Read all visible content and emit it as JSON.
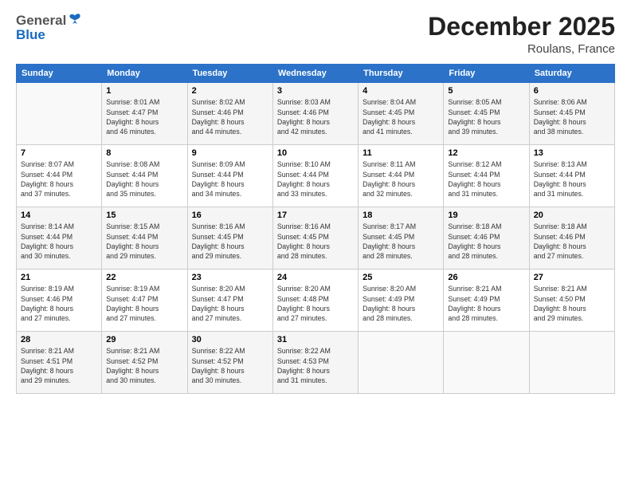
{
  "header": {
    "logo_general": "General",
    "logo_blue": "Blue",
    "month_title": "December 2025",
    "location": "Roulans, France"
  },
  "days_of_week": [
    "Sunday",
    "Monday",
    "Tuesday",
    "Wednesday",
    "Thursday",
    "Friday",
    "Saturday"
  ],
  "weeks": [
    [
      {
        "day": "",
        "info": ""
      },
      {
        "day": "1",
        "info": "Sunrise: 8:01 AM\nSunset: 4:47 PM\nDaylight: 8 hours\nand 46 minutes."
      },
      {
        "day": "2",
        "info": "Sunrise: 8:02 AM\nSunset: 4:46 PM\nDaylight: 8 hours\nand 44 minutes."
      },
      {
        "day": "3",
        "info": "Sunrise: 8:03 AM\nSunset: 4:46 PM\nDaylight: 8 hours\nand 42 minutes."
      },
      {
        "day": "4",
        "info": "Sunrise: 8:04 AM\nSunset: 4:45 PM\nDaylight: 8 hours\nand 41 minutes."
      },
      {
        "day": "5",
        "info": "Sunrise: 8:05 AM\nSunset: 4:45 PM\nDaylight: 8 hours\nand 39 minutes."
      },
      {
        "day": "6",
        "info": "Sunrise: 8:06 AM\nSunset: 4:45 PM\nDaylight: 8 hours\nand 38 minutes."
      }
    ],
    [
      {
        "day": "7",
        "info": "Sunrise: 8:07 AM\nSunset: 4:44 PM\nDaylight: 8 hours\nand 37 minutes."
      },
      {
        "day": "8",
        "info": "Sunrise: 8:08 AM\nSunset: 4:44 PM\nDaylight: 8 hours\nand 35 minutes."
      },
      {
        "day": "9",
        "info": "Sunrise: 8:09 AM\nSunset: 4:44 PM\nDaylight: 8 hours\nand 34 minutes."
      },
      {
        "day": "10",
        "info": "Sunrise: 8:10 AM\nSunset: 4:44 PM\nDaylight: 8 hours\nand 33 minutes."
      },
      {
        "day": "11",
        "info": "Sunrise: 8:11 AM\nSunset: 4:44 PM\nDaylight: 8 hours\nand 32 minutes."
      },
      {
        "day": "12",
        "info": "Sunrise: 8:12 AM\nSunset: 4:44 PM\nDaylight: 8 hours\nand 31 minutes."
      },
      {
        "day": "13",
        "info": "Sunrise: 8:13 AM\nSunset: 4:44 PM\nDaylight: 8 hours\nand 31 minutes."
      }
    ],
    [
      {
        "day": "14",
        "info": "Sunrise: 8:14 AM\nSunset: 4:44 PM\nDaylight: 8 hours\nand 30 minutes."
      },
      {
        "day": "15",
        "info": "Sunrise: 8:15 AM\nSunset: 4:44 PM\nDaylight: 8 hours\nand 29 minutes."
      },
      {
        "day": "16",
        "info": "Sunrise: 8:16 AM\nSunset: 4:45 PM\nDaylight: 8 hours\nand 29 minutes."
      },
      {
        "day": "17",
        "info": "Sunrise: 8:16 AM\nSunset: 4:45 PM\nDaylight: 8 hours\nand 28 minutes."
      },
      {
        "day": "18",
        "info": "Sunrise: 8:17 AM\nSunset: 4:45 PM\nDaylight: 8 hours\nand 28 minutes."
      },
      {
        "day": "19",
        "info": "Sunrise: 8:18 AM\nSunset: 4:46 PM\nDaylight: 8 hours\nand 28 minutes."
      },
      {
        "day": "20",
        "info": "Sunrise: 8:18 AM\nSunset: 4:46 PM\nDaylight: 8 hours\nand 27 minutes."
      }
    ],
    [
      {
        "day": "21",
        "info": "Sunrise: 8:19 AM\nSunset: 4:46 PM\nDaylight: 8 hours\nand 27 minutes."
      },
      {
        "day": "22",
        "info": "Sunrise: 8:19 AM\nSunset: 4:47 PM\nDaylight: 8 hours\nand 27 minutes."
      },
      {
        "day": "23",
        "info": "Sunrise: 8:20 AM\nSunset: 4:47 PM\nDaylight: 8 hours\nand 27 minutes."
      },
      {
        "day": "24",
        "info": "Sunrise: 8:20 AM\nSunset: 4:48 PM\nDaylight: 8 hours\nand 27 minutes."
      },
      {
        "day": "25",
        "info": "Sunrise: 8:20 AM\nSunset: 4:49 PM\nDaylight: 8 hours\nand 28 minutes."
      },
      {
        "day": "26",
        "info": "Sunrise: 8:21 AM\nSunset: 4:49 PM\nDaylight: 8 hours\nand 28 minutes."
      },
      {
        "day": "27",
        "info": "Sunrise: 8:21 AM\nSunset: 4:50 PM\nDaylight: 8 hours\nand 29 minutes."
      }
    ],
    [
      {
        "day": "28",
        "info": "Sunrise: 8:21 AM\nSunset: 4:51 PM\nDaylight: 8 hours\nand 29 minutes."
      },
      {
        "day": "29",
        "info": "Sunrise: 8:21 AM\nSunset: 4:52 PM\nDaylight: 8 hours\nand 30 minutes."
      },
      {
        "day": "30",
        "info": "Sunrise: 8:22 AM\nSunset: 4:52 PM\nDaylight: 8 hours\nand 30 minutes."
      },
      {
        "day": "31",
        "info": "Sunrise: 8:22 AM\nSunset: 4:53 PM\nDaylight: 8 hours\nand 31 minutes."
      },
      {
        "day": "",
        "info": ""
      },
      {
        "day": "",
        "info": ""
      },
      {
        "day": "",
        "info": ""
      }
    ]
  ]
}
